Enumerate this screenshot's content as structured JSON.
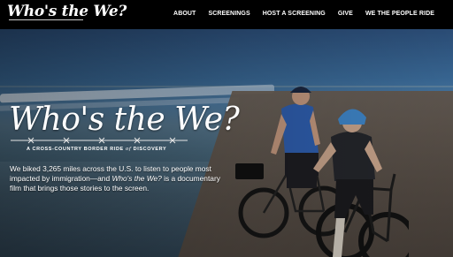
{
  "site": {
    "logo_text": "Who's the We?"
  },
  "nav": {
    "items": [
      {
        "label": "ABOUT"
      },
      {
        "label": "SCREENINGS"
      },
      {
        "label": "HOST A SCREENING"
      },
      {
        "label": "GIVE"
      },
      {
        "label": "WE THE PEOPLE RIDE"
      }
    ]
  },
  "hero": {
    "title": "Who's the We?",
    "subtitle_before": "A CROSS-COUNTRY BORDER RIDE",
    "subtitle_of": "of",
    "subtitle_after": "DISCOVERY",
    "description_part1": "We biked 3,265 miles across the U.S. to listen to people most impacted by immigration—and ",
    "description_film_title": "Who's the We?",
    "description_part2": " is a documentary film that brings those stories to the screen."
  },
  "colors": {
    "topbar_bg": "#000000",
    "text": "#ffffff",
    "rider_shirt_blue": "#2f5fb0",
    "helmet_blue": "#3f86c9"
  },
  "icons": {
    "logo_wire": "barbed-wire-icon",
    "title_wire": "barbed-wire-icon"
  }
}
